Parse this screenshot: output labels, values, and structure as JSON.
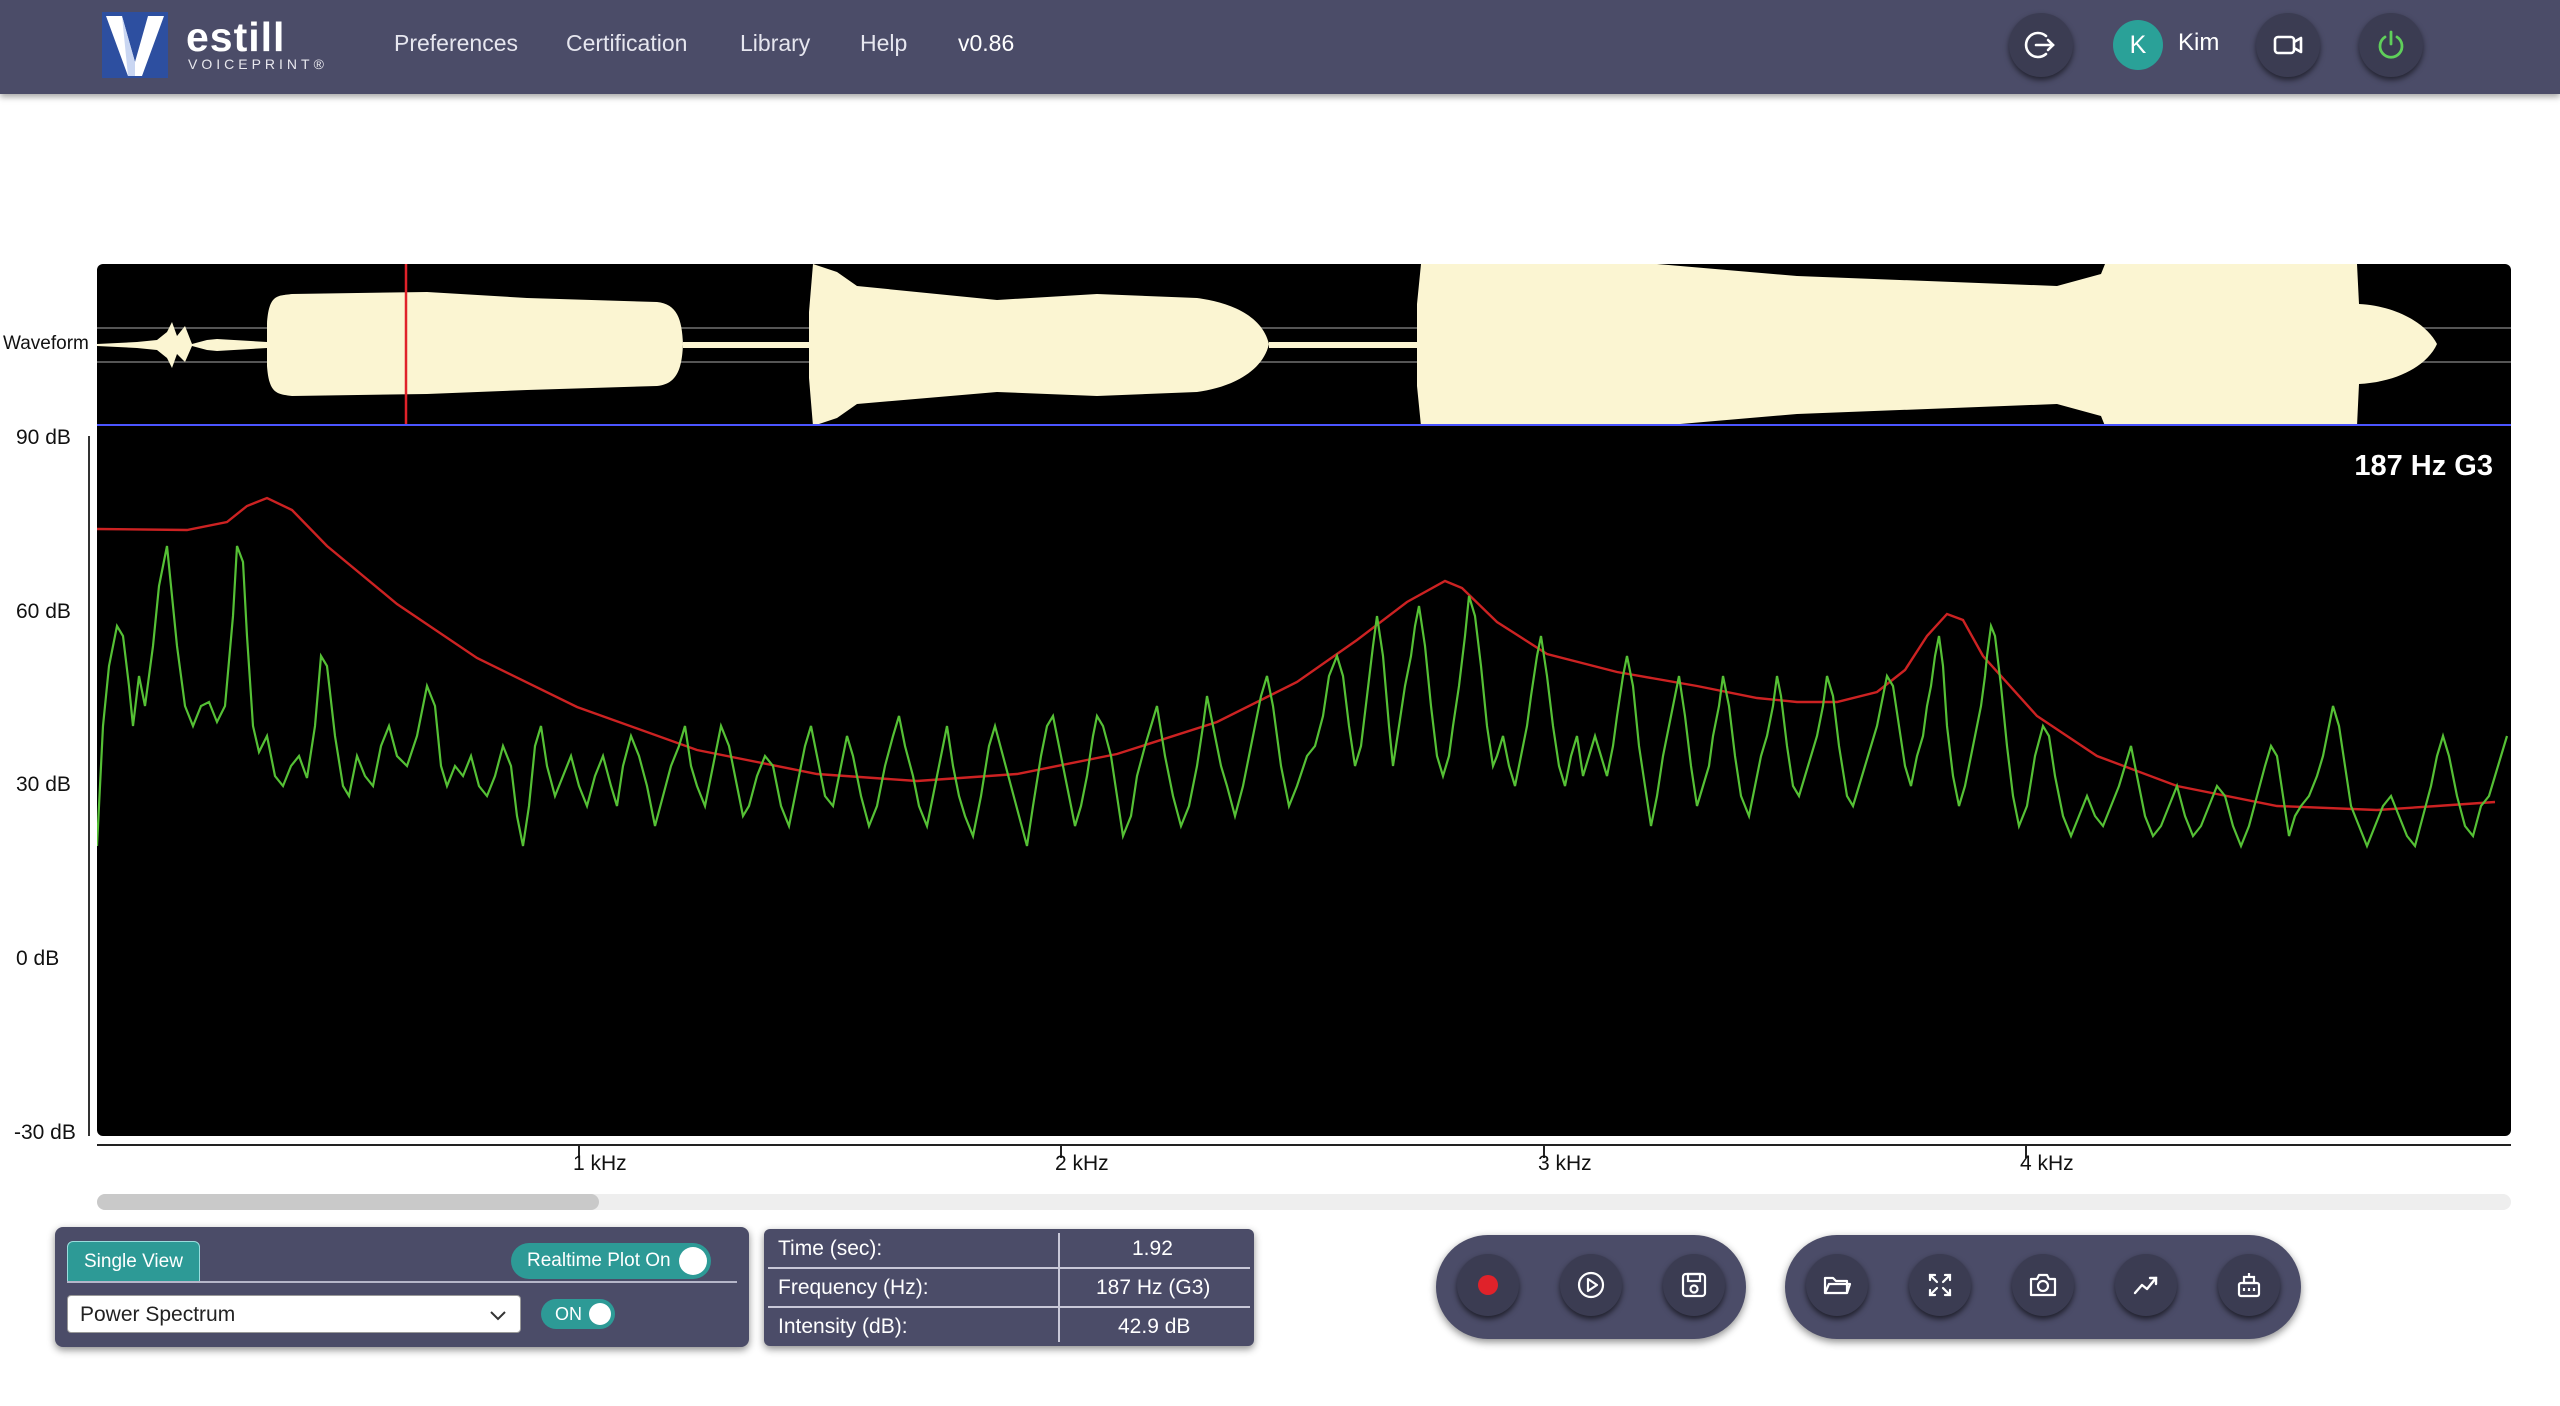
{
  "brand": {
    "name": "estill",
    "subtitle": "VOICEPRINT®"
  },
  "nav": {
    "preferences": "Preferences",
    "certification": "Certification",
    "library": "Library",
    "help": "Help",
    "version": "v0.86"
  },
  "user": {
    "initial": "K",
    "name": "Kim"
  },
  "header_icons": [
    "logout-icon",
    "video-camera-icon",
    "power-icon"
  ],
  "waveform": {
    "label": "Waveform",
    "playhead_time_sec": 1.92
  },
  "spectrum": {
    "pitch_readout": "187 Hz G3",
    "y_ticks": [
      "90 dB",
      "60 dB",
      "30 dB",
      "0 dB",
      "-30 dB"
    ],
    "x_ticks": [
      "1 kHz",
      "2 kHz",
      "3 kHz",
      "4 kHz"
    ],
    "colors": {
      "spectrum": "#55c035",
      "envelope": "#cc2222",
      "background": "#000000"
    }
  },
  "controls": {
    "view_tab": "Single View",
    "realtime_toggle": "Realtime Plot On",
    "realtime_on": true,
    "plot_type": "Power Spectrum",
    "plot_toggle": "ON",
    "plot_on": true
  },
  "readout": {
    "time_label": "Time (sec):",
    "time_value": "1.92",
    "freq_label": "Frequency (Hz):",
    "freq_value": "187 Hz (G3)",
    "intensity_label": "Intensity (dB):",
    "intensity_value": "42.9 dB"
  },
  "transport_icons": [
    "record-icon",
    "play-icon",
    "save-icon"
  ],
  "tool_icons": [
    "open-folder-icon",
    "fullscreen-icon",
    "camera-icon",
    "trend-line-icon",
    "settings-icon"
  ],
  "accent": "#2d9a96",
  "panel_color": "#4b4c68"
}
